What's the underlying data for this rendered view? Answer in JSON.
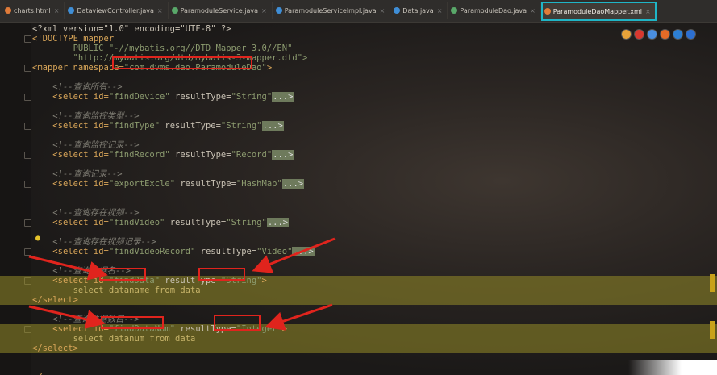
{
  "tabs": [
    {
      "label": "charts.html",
      "icon": "html-file-icon",
      "color": "#e07b39",
      "active": false
    },
    {
      "label": "DataviewController.java",
      "icon": "java-class-icon",
      "color": "#3f8ed6",
      "active": false
    },
    {
      "label": "ParamoduleService.java",
      "icon": "java-interface-icon",
      "color": "#59a869",
      "active": false
    },
    {
      "label": "ParamoduleServiceImpl.java",
      "icon": "java-class-icon",
      "color": "#3f8ed6",
      "active": false
    },
    {
      "label": "Data.java",
      "icon": "java-class-icon",
      "color": "#3f8ed6",
      "active": false
    },
    {
      "label": "ParamoduleDao.java",
      "icon": "java-interface-icon",
      "color": "#59a869",
      "active": false
    },
    {
      "label": "ParamoduleDaoMapper.xml",
      "icon": "xml-file-icon",
      "color": "#e07b39",
      "active": true
    }
  ],
  "browser_icons": [
    "chrome-icon",
    "opera-icon",
    "firefox-icon",
    "safari-icon",
    "ie-icon",
    "edge-icon"
  ],
  "code": {
    "xml_decl": "<?xml version=\"1.0\" encoding=\"UTF-8\" ?>",
    "doctype_1": "<!DOCTYPE mapper",
    "doctype_2": "        PUBLIC \"-//mybatis.org//DTD Mapper 3.0//EN\"",
    "doctype_3": "        \"http://mybatis.org/dtd/mybatis-3-mapper.dtd\">",
    "mapper_open": "<mapper namespace=",
    "mapper_ns": "\"com.dvms.dao.ParamoduleDao\"",
    "mapper_close": ">",
    "blocks": [
      {
        "comment": "<!--查询所有-->",
        "tag_open": "<select id=",
        "id": "\"findDevice\"",
        "rest": " resultType=",
        "type": "\"String\"",
        "ellipsis": "...>"
      },
      {
        "comment": "<!--查询监控类型-->",
        "tag_open": "<select id=",
        "id": "\"findType\"",
        "rest": " resultType=",
        "type": "\"String\"",
        "ellipsis": "...>"
      },
      {
        "comment": "<!--查询监控记录-->",
        "tag_open": "<select id=",
        "id": "\"findRecord\"",
        "rest": " resultType=",
        "type": "\"Record\"",
        "ellipsis": "...>"
      },
      {
        "comment": "<!--查询记录-->",
        "tag_open": "<select id=",
        "id": "\"exportExcle\"",
        "rest": " resultType=",
        "type": "\"HashMap\"",
        "ellipsis": "...>"
      },
      {
        "comment": "<!--查询存在视频-->",
        "tag_open": "<select id=",
        "id": "\"findVideo\"",
        "rest": " resultType=",
        "type": "\"String\"",
        "ellipsis": "...>"
      },
      {
        "comment": "<!--查询存在视频记录-->",
        "tag_open": "<select id=",
        "id": "\"findVideoRecord\"",
        "rest": " resultType=",
        "type": "\"Video\"",
        "ellipsis": "...>"
      }
    ],
    "data_block": {
      "comment": "<!--查询数据名-->",
      "tag_open": "<select id=",
      "id": "\"findData\"",
      "rest": " resultType=",
      "type": "\"String\"",
      "close_bracket": ">",
      "sql": "    select dataname from data",
      "end": "</select>"
    },
    "num_block": {
      "comment": "<!--查询数据数目-->",
      "tag_open": "<select id=",
      "id": "\"findDataNum\"",
      "rest": " resultType=",
      "type": "\"Integer\"",
      "close_bracket": ">",
      "sql": "    select datanum from data",
      "end": "</select>"
    },
    "mapper_end": "</mapper>"
  }
}
